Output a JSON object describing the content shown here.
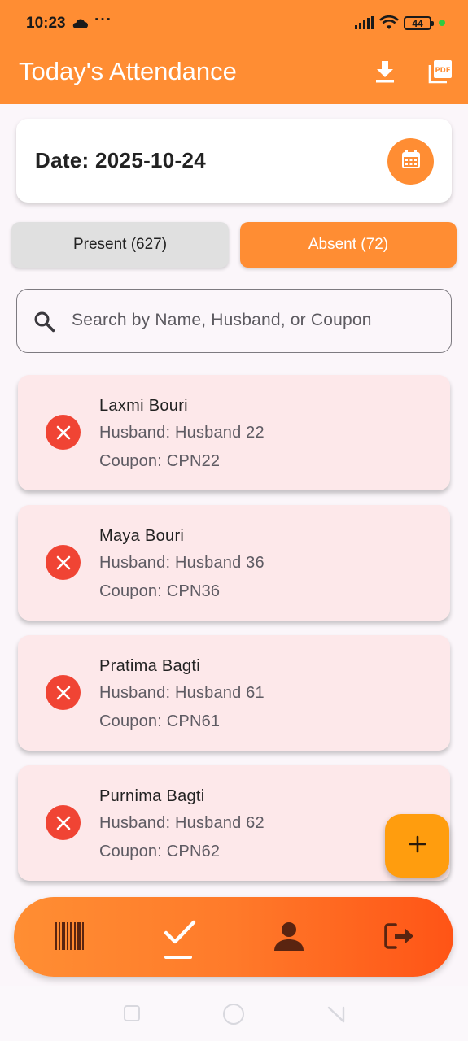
{
  "status_bar": {
    "time": "10:23",
    "dots": "···",
    "battery": "44"
  },
  "app_bar": {
    "title": "Today's Attendance",
    "actions": [
      {
        "icon": "download-icon"
      },
      {
        "icon": "pdf-icon"
      }
    ]
  },
  "date_card": {
    "label": "Date: 2025-10-24",
    "icon": "calendar-icon"
  },
  "tabs": {
    "present_label": "Present (627)",
    "absent_label": "Absent (72)",
    "selected": "absent"
  },
  "search": {
    "placeholder": "Search by Name, Husband, or Coupon",
    "icon": "search-icon"
  },
  "absent_list": [
    {
      "name": "Laxmi Bouri",
      "husband": "Husband: Husband 22",
      "coupon": "Coupon: CPN22"
    },
    {
      "name": "Maya Bouri",
      "husband": "Husband: Husband 36",
      "coupon": "Coupon: CPN36"
    },
    {
      "name": "Pratima Bagti",
      "husband": "Husband: Husband 61",
      "coupon": "Coupon: CPN61"
    },
    {
      "name": "Purnima Bagti",
      "husband": "Husband: Husband 62",
      "coupon": "Coupon: CPN62"
    }
  ],
  "fab": {
    "icon": "plus-icon"
  },
  "bottom_nav": {
    "items": [
      {
        "icon": "barcode-icon"
      },
      {
        "icon": "check-icon",
        "active": true
      },
      {
        "icon": "person-icon"
      },
      {
        "icon": "logout-icon"
      }
    ]
  },
  "colors": {
    "primary": "#ff8d33",
    "card_absent": "#fde8ea",
    "absent_icon": "#f04434",
    "fab": "#ff9d0e"
  }
}
